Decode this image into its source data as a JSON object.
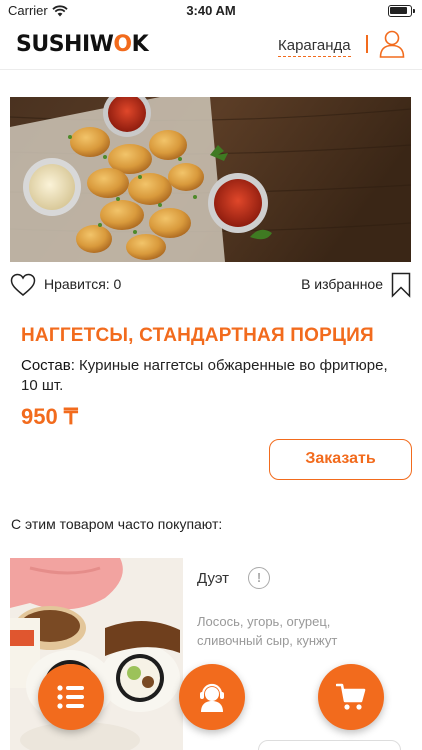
{
  "status_bar": {
    "carrier": "Carrier",
    "time": "3:40 AM"
  },
  "header": {
    "logo_text_1": "SUSHIW",
    "logo_text_2": "O",
    "logo_text_3": "K",
    "city": "Караганда"
  },
  "product": {
    "likes_label": "Нравится: 0",
    "favorites_label": "В избранное",
    "title": "НАГГЕТСЫ, СТАНДАРТНАЯ ПОРЦИЯ",
    "composition_label": "Состав:",
    "composition_text": " Куриные наггетсы обжаренные во фритюре, 10 шт.",
    "price": "950 ₸",
    "order_button": "Заказать"
  },
  "recommendations": {
    "heading": "С этим товаром часто покупают:",
    "items": [
      {
        "name": "Дуэт",
        "info_icon": "!",
        "description": "Лосось, угорь, огурец, сливочный сыр, кунжут"
      }
    ]
  },
  "colors": {
    "accent": "#f26b1d"
  },
  "icons": [
    "wifi-icon",
    "battery-icon",
    "user-icon",
    "heart-icon",
    "bookmark-icon",
    "info-icon",
    "menu-icon",
    "support-headset-icon",
    "cart-icon"
  ]
}
